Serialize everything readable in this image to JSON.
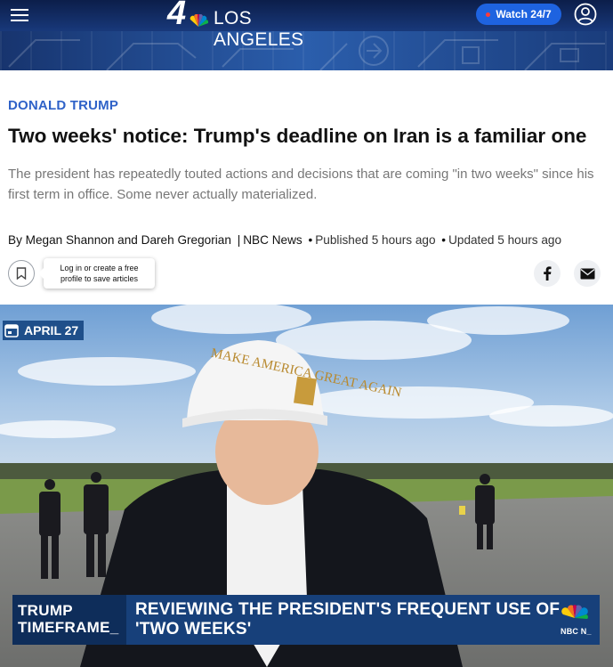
{
  "header": {
    "station_number": "4",
    "city": "LOS ANGELES",
    "watch_label": "Watch 24/7",
    "brand_blue": "#1b3f86",
    "accent": "#1e63e0",
    "icons": [
      "menu-icon",
      "peacock-logo-icon",
      "live-dot-icon",
      "user-icon"
    ]
  },
  "article": {
    "category": "DONALD TRUMP",
    "headline": "Two weeks' notice: Trump's deadline on Iran is a familiar one",
    "dek": "The president has repeatedly touted actions and decisions that are coming \"in two weeks\" since his first term in office. Some never actually materialized.",
    "byline": {
      "authors": "By Megan Shannon and Dareh Gregorian",
      "outlet": "NBC News",
      "published": "Published 5 hours ago",
      "updated": "Updated 5 hours ago"
    },
    "save_tooltip": "Log in or create a free profile to save articles",
    "share_icons": [
      "facebook-icon",
      "email-icon"
    ]
  },
  "video": {
    "date_badge": "APRIL 27",
    "lower_third_left_line1": "TRUMP",
    "lower_third_left_line2": "TIMEFRAME_",
    "lower_third_right": "REVIEWING THE PRESIDENT'S FREQUENT USE OF 'TWO WEEKS'",
    "corner_logo_text": "NBC N_",
    "cap_text": "MAKE AMERICA GREAT AGAIN"
  }
}
